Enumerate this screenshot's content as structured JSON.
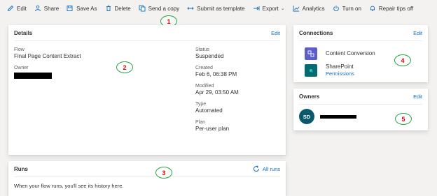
{
  "toolbar": {
    "edit": "Edit",
    "share": "Share",
    "save_as": "Save As",
    "delete": "Delete",
    "send_copy": "Send a copy",
    "submit_template": "Submit as template",
    "export": "Export",
    "analytics": "Analytics",
    "turn_on": "Turn on",
    "repair_tips": "Repair tips off"
  },
  "details": {
    "title": "Details",
    "edit": "Edit",
    "flow_label": "Flow",
    "flow_value": "Final Page Content Extract",
    "owner_label": "Owner",
    "status_label": "Status",
    "status_value": "Suspended",
    "created_label": "Created",
    "created_value": "Feb 6, 06:38 PM",
    "modified_label": "Modified",
    "modified_value": "Apr 29, 03:50 AM",
    "type_label": "Type",
    "type_value": "Automated",
    "plan_label": "Plan",
    "plan_value": "Per-user plan"
  },
  "runs": {
    "title": "Runs",
    "all_runs": "All runs",
    "empty_text": "When your flow runs, you'll see its history here."
  },
  "connections": {
    "title": "Connections",
    "edit": "Edit",
    "items": [
      {
        "name": "Content Conversion",
        "icon": "content-conversion-icon",
        "color": "#5b5fc7"
      },
      {
        "name": "SharePoint",
        "link": "Permissions",
        "icon": "sharepoint-icon",
        "color": "#036c70"
      }
    ]
  },
  "owners": {
    "title": "Owners",
    "edit": "Edit",
    "initials": "SD"
  },
  "annotations": [
    "1",
    "2",
    "3",
    "4",
    "5"
  ],
  "colors": {
    "accent": "#0f6cbd",
    "annotation_ring": "#2aa44a",
    "annotation_text": "#e00000",
    "avatar": "#0b5a6b"
  }
}
